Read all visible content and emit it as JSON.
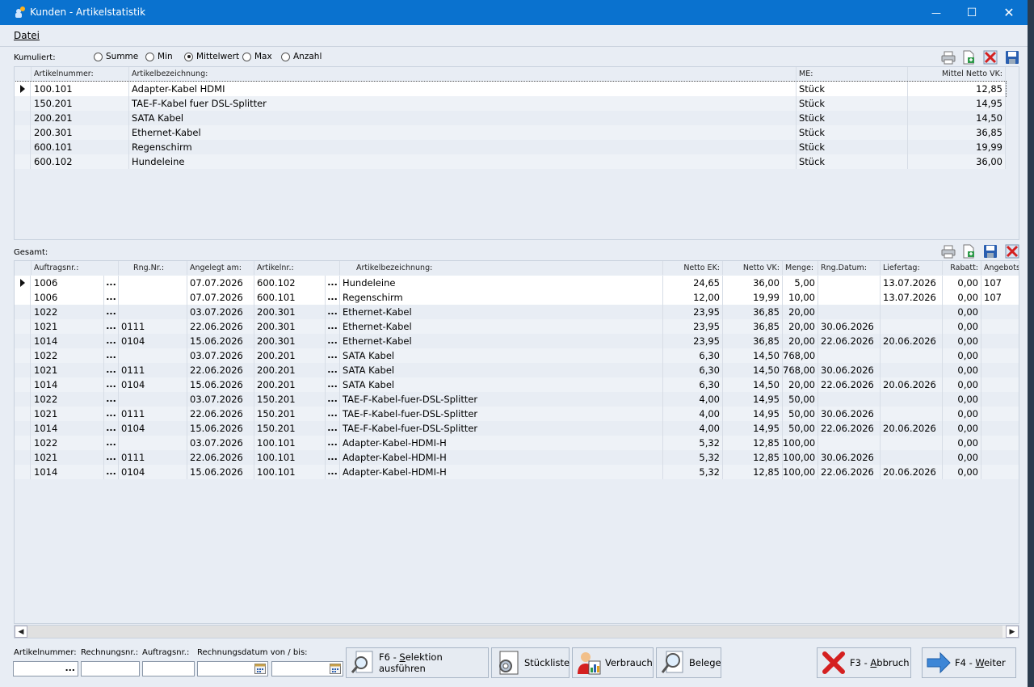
{
  "window": {
    "title": "Kunden - Artikelstatistik",
    "min": "—",
    "max": "☐",
    "close": "✕"
  },
  "menu": {
    "file": "Datei"
  },
  "cumulated": {
    "label": "Kumuliert:",
    "options": [
      "Summe",
      "Min",
      "Mittelwert",
      "Max",
      "Anzahl"
    ],
    "selected": "Mittelwert"
  },
  "top_grid": {
    "headers": [
      "Artikelnummer:",
      "Artikelbezeichnung:",
      "ME:",
      "Mittel Netto VK:"
    ],
    "rows": [
      [
        "100.101",
        "Adapter-Kabel HDMI",
        "Stück",
        "12,85"
      ],
      [
        "150.201",
        "TAE-F-Kabel fuer DSL-Splitter",
        "Stück",
        "14,95"
      ],
      [
        "200.201",
        "SATA Kabel",
        "Stück",
        "14,50"
      ],
      [
        "200.301",
        "Ethernet-Kabel",
        "Stück",
        "36,85"
      ],
      [
        "600.101",
        "Regenschirm",
        "Stück",
        "19,99"
      ],
      [
        "600.102",
        "Hundeleine",
        "Stück",
        "36,00"
      ]
    ]
  },
  "bottom_grid": {
    "label": "Gesamt:",
    "headers": [
      "Auftragsnr.:",
      "Rng.Nr.:",
      "Angelegt am:",
      "Artikelnr.:",
      "Artikelbezeichnung:",
      "Netto EK:",
      "Netto VK:",
      "Menge:",
      "Rng.Datum:",
      "Liefertag:",
      "Rabatt:",
      "Angebots"
    ],
    "dots": "...",
    "rows": [
      [
        "1006",
        "",
        "07.07.2026",
        "600.102",
        "Hundeleine",
        "24,65",
        "36,00",
        "5,00",
        "",
        "13.07.2026",
        "0,00",
        "107"
      ],
      [
        "1006",
        "",
        "07.07.2026",
        "600.101",
        "Regenschirm",
        "12,00",
        "19,99",
        "10,00",
        "",
        "13.07.2026",
        "0,00",
        "107"
      ],
      [
        "1022",
        "",
        "03.07.2026",
        "200.301",
        "Ethernet-Kabel",
        "23,95",
        "36,85",
        "20,00",
        "",
        "",
        "0,00",
        ""
      ],
      [
        "1021",
        "0111",
        "22.06.2026",
        "200.301",
        "Ethernet-Kabel",
        "23,95",
        "36,85",
        "20,00",
        "30.06.2026",
        "",
        "0,00",
        ""
      ],
      [
        "1014",
        "0104",
        "15.06.2026",
        "200.301",
        "Ethernet-Kabel",
        "23,95",
        "36,85",
        "20,00",
        "22.06.2026",
        "20.06.2026",
        "0,00",
        ""
      ],
      [
        "1022",
        "",
        "03.07.2026",
        "200.201",
        "SATA Kabel",
        "6,30",
        "14,50",
        "768,00",
        "",
        "",
        "0,00",
        ""
      ],
      [
        "1021",
        "0111",
        "22.06.2026",
        "200.201",
        "SATA Kabel",
        "6,30",
        "14,50",
        "768,00",
        "30.06.2026",
        "",
        "0,00",
        ""
      ],
      [
        "1014",
        "0104",
        "15.06.2026",
        "200.201",
        "SATA Kabel",
        "6,30",
        "14,50",
        "20,00",
        "22.06.2026",
        "20.06.2026",
        "0,00",
        ""
      ],
      [
        "1022",
        "",
        "03.07.2026",
        "150.201",
        "TAE-F-Kabel-fuer-DSL-Splitter",
        "4,00",
        "14,95",
        "50,00",
        "",
        "",
        "0,00",
        ""
      ],
      [
        "1021",
        "0111",
        "22.06.2026",
        "150.201",
        "TAE-F-Kabel-fuer-DSL-Splitter",
        "4,00",
        "14,95",
        "50,00",
        "30.06.2026",
        "",
        "0,00",
        ""
      ],
      [
        "1014",
        "0104",
        "15.06.2026",
        "150.201",
        "TAE-F-Kabel-fuer-DSL-Splitter",
        "4,00",
        "14,95",
        "50,00",
        "22.06.2026",
        "20.06.2026",
        "0,00",
        ""
      ],
      [
        "1022",
        "",
        "03.07.2026",
        "100.101",
        "Adapter-Kabel-HDMI-H",
        "5,32",
        "12,85",
        "100,00",
        "",
        "",
        "0,00",
        ""
      ],
      [
        "1021",
        "0111",
        "22.06.2026",
        "100.101",
        "Adapter-Kabel-HDMI-H",
        "5,32",
        "12,85",
        "100,00",
        "30.06.2026",
        "",
        "0,00",
        ""
      ],
      [
        "1014",
        "0104",
        "15.06.2026",
        "100.101",
        "Adapter-Kabel-HDMI-H",
        "5,32",
        "12,85",
        "100,00",
        "22.06.2026",
        "20.06.2026",
        "0,00",
        ""
      ]
    ]
  },
  "filters": {
    "article_label": "Artikelnummer:",
    "invoice_label": "Rechnungsnr.:",
    "order_label": "Auftragsnr.:",
    "date_label": "Rechnungsdatum von / bis:",
    "article_value": "",
    "invoice_value": "",
    "order_value": "",
    "date_from": "",
    "date_to": "",
    "dots": "..."
  },
  "buttons": {
    "selection_prefix": "F6 - ",
    "selection_key": "S",
    "selection_rest": "elektion ausführen",
    "bom": "Stückliste",
    "usage": "Verbrauch",
    "documents": "Belege",
    "cancel_prefix": "F3 - ",
    "cancel_key": "A",
    "cancel_rest": "bbruch",
    "next_prefix": "F4 - ",
    "next_key": "W",
    "next_rest": "eiter"
  },
  "icons": [
    "app-icon",
    "print-icon",
    "export-icon",
    "delete-icon",
    "save-icon",
    "search-icon",
    "bom-icon",
    "usage-icon",
    "documents-icon",
    "cancel-icon",
    "next-arrow-icon",
    "calendar-icon"
  ],
  "colors": {
    "titlebar": "#0a72cf",
    "window_bg": "#e8edf4",
    "row_alt": "#eef2f7",
    "row_bg": "#ffffff"
  }
}
